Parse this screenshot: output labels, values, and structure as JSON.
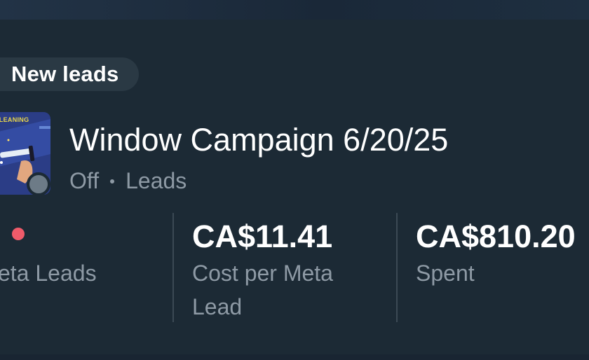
{
  "header": {
    "badge_label": "New leads"
  },
  "campaign": {
    "thumbnail_text": "CLEANING",
    "name": "Window Campaign 6/20/25",
    "status": "Off",
    "objective": "Leads",
    "status_color": "#6d7b87"
  },
  "metrics": [
    {
      "value": "",
      "label": "eta Leads",
      "indicator_color": "#ef5b6a"
    },
    {
      "value": "CA$11.41",
      "label_line1": "Cost per Meta",
      "label_line2": "Lead"
    },
    {
      "value": "CA$810.20",
      "label": "Spent"
    }
  ],
  "colors": {
    "background": "#1c2a35",
    "pill": "#2a3944",
    "muted_text": "#8e9aa5",
    "divider": "#3b4954"
  }
}
